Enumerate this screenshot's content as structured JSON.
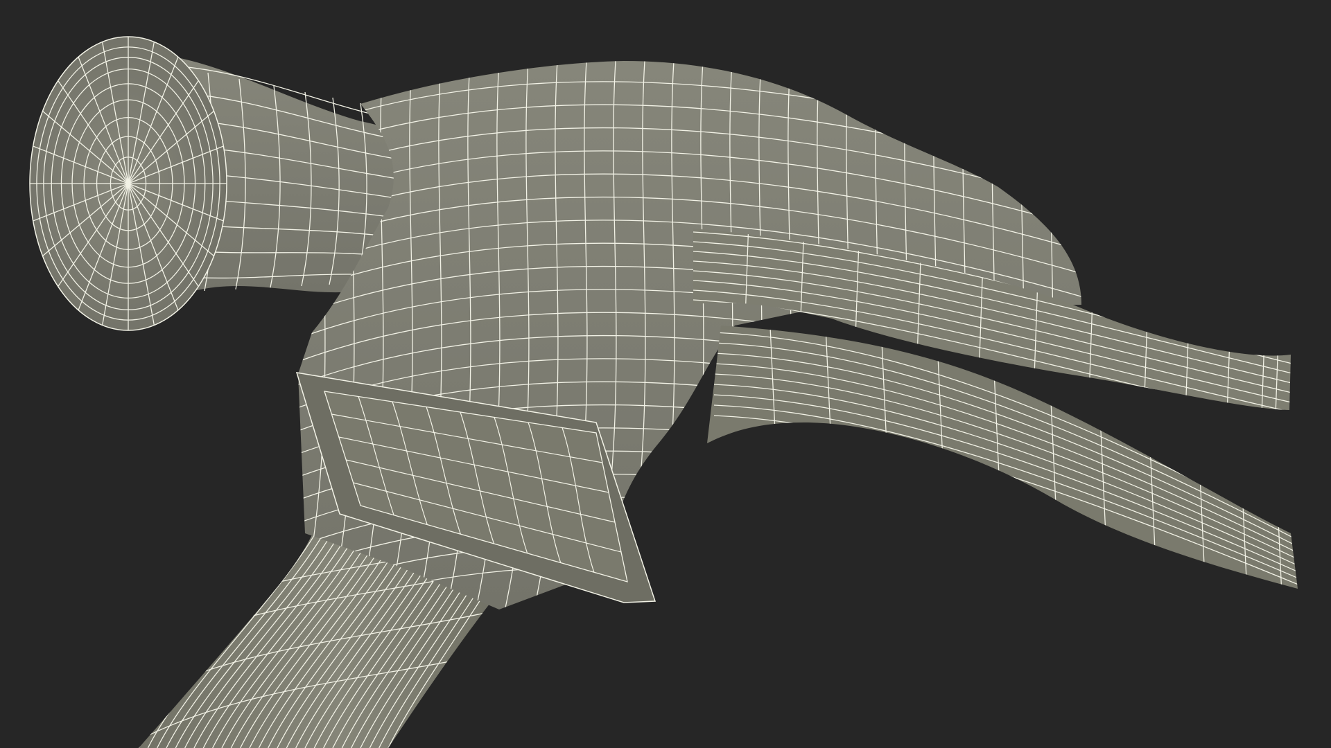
{
  "scene": {
    "subject": "claw-hammer-wireframe",
    "colors": {
      "background": "#262626",
      "surface": "#808070",
      "surface_light": "#8e8e7d",
      "surface_dark": "#6a6a5c",
      "wire": "#f2f2e6"
    }
  }
}
